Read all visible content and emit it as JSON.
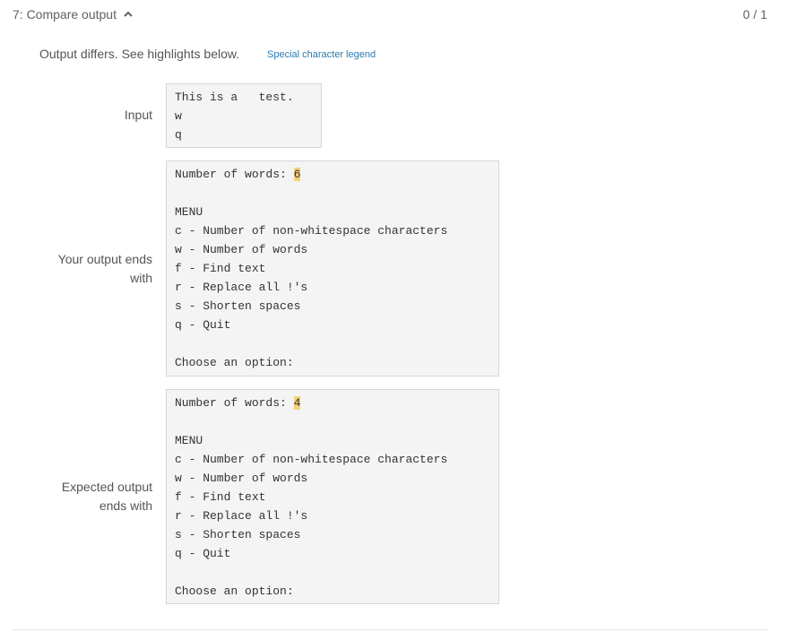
{
  "header": {
    "title": "7: Compare output",
    "chevron_icon": "chevron-up-icon",
    "score": "0 / 1"
  },
  "status": {
    "message": "Output differs. See highlights below.",
    "legend_link": "Special character legend"
  },
  "colors": {
    "highlight": "#f5d27a",
    "link": "#2a7ab0",
    "box_bg": "#f4f4f4"
  },
  "input": {
    "label": "Input",
    "lines": [
      "This is a   test.",
      "w",
      "q"
    ]
  },
  "your_output": {
    "label_line1": "Your output ends",
    "label_line2": "with",
    "first_prefix": "Number of words: ",
    "first_value": "6",
    "lines": [
      "",
      "MENU",
      "c - Number of non-whitespace characters",
      "w - Number of words",
      "f - Find text",
      "r - Replace all !'s",
      "s - Shorten spaces",
      "q - Quit",
      "",
      "Choose an option:"
    ]
  },
  "expected_output": {
    "label_line1": "Expected output",
    "label_line2": "ends with",
    "first_prefix": "Number of words: ",
    "first_value": "4",
    "lines": [
      "",
      "MENU",
      "c - Number of non-whitespace characters",
      "w - Number of words",
      "f - Find text",
      "r - Replace all !'s",
      "s - Shorten spaces",
      "q - Quit",
      "",
      "Choose an option:"
    ]
  }
}
